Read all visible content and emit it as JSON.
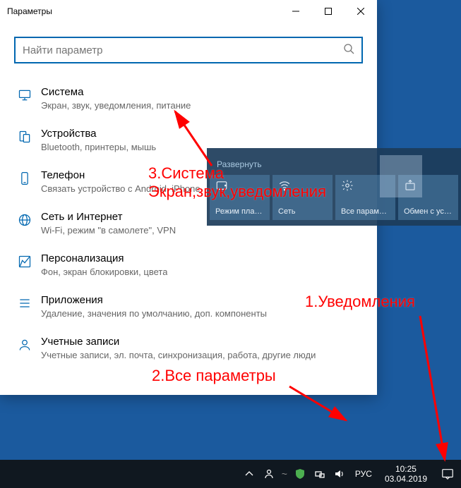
{
  "window": {
    "title": "Параметры",
    "search_placeholder": "Найти параметр"
  },
  "items": [
    {
      "title": "Система",
      "desc": "Экран, звук, уведомления, питание"
    },
    {
      "title": "Устройства",
      "desc": "Bluetooth, принтеры, мышь"
    },
    {
      "title": "Телефон",
      "desc": "Связать устройство с Android, iPhone"
    },
    {
      "title": "Сеть и Интернет",
      "desc": "Wi-Fi, режим \"в самолете\", VPN"
    },
    {
      "title": "Персонализация",
      "desc": "Фон, экран блокировки, цвета"
    },
    {
      "title": "Приложения",
      "desc": "Удаление, значения по умолчанию, доп. компоненты"
    },
    {
      "title": "Учетные записи",
      "desc": "Учетные записи, эл. почта, синхронизация, работа, другие люди"
    }
  ],
  "action_center": {
    "expand": "Развернуть",
    "tiles": [
      {
        "label": "Режим планшета"
      },
      {
        "label": "Сеть"
      },
      {
        "label": "Все параметры"
      },
      {
        "label": "Обмен с устройствами"
      }
    ]
  },
  "taskbar": {
    "lang": "РУС",
    "time": "10:25",
    "date": "03.04.2019"
  },
  "annotations": {
    "a1": "1.Уведомления",
    "a2": "2.Все параметры",
    "a3_l1": "3.Система",
    "a3_l2": "Экран,звук,уведомления"
  }
}
